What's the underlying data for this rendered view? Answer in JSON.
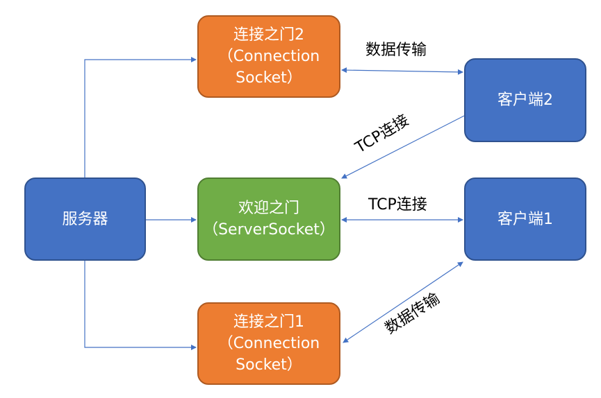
{
  "nodes": {
    "server": {
      "line1": "服务器"
    },
    "conn2": {
      "line1": "连接之门2",
      "line2": "（Connection",
      "line3": "Socket）"
    },
    "welcome": {
      "line1": "欢迎之门",
      "line2": "（ServerSocket）"
    },
    "conn1": {
      "line1": "连接之门1",
      "line2": "（Connection",
      "line3": "Socket）"
    },
    "client2": {
      "line1": "客户端2"
    },
    "client1": {
      "line1": "客户端1"
    }
  },
  "edges": {
    "data_top": "数据传输",
    "tcp_mid": "TCP连接",
    "tcp_diag": "TCP连接",
    "data_bottom": "数据传输"
  },
  "colors": {
    "blue": "#4472c4",
    "orange": "#ed7d31",
    "green": "#70ad47",
    "arrow": "#4472c4"
  }
}
